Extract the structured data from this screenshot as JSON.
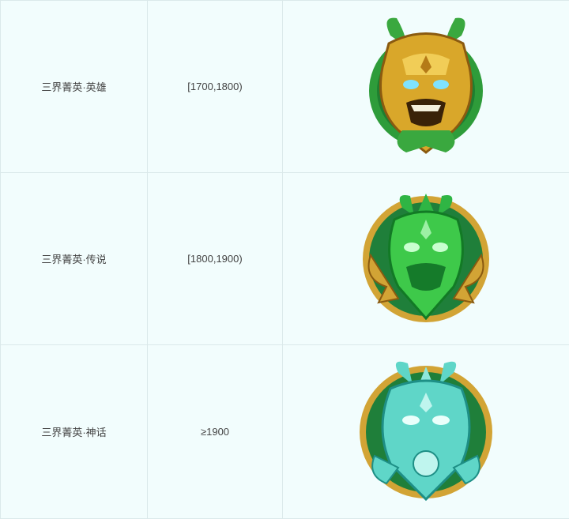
{
  "rows": [
    {
      "tier": "三界菁英·英雄",
      "range": "[1700,1800)",
      "badge_icon": "gold-beast-badge-icon",
      "colors": {
        "rim": "#2f9a3a",
        "metal": "#d9a72a",
        "accent": "#b57a17"
      }
    },
    {
      "tier": "三界菁英·传说",
      "range": "[1800,1900)",
      "badge_icon": "jade-dragon-badge-icon",
      "colors": {
        "rim": "#d2a435",
        "metal": "#3ec94a",
        "accent": "#188a2a"
      }
    },
    {
      "tier": "三界菁英·神话",
      "range": "≥1900",
      "badge_icon": "turquoise-beast-badge-icon",
      "colors": {
        "rim": "#d2a435",
        "metal": "#5fd6c8",
        "accent": "#1e8f86"
      }
    }
  ]
}
